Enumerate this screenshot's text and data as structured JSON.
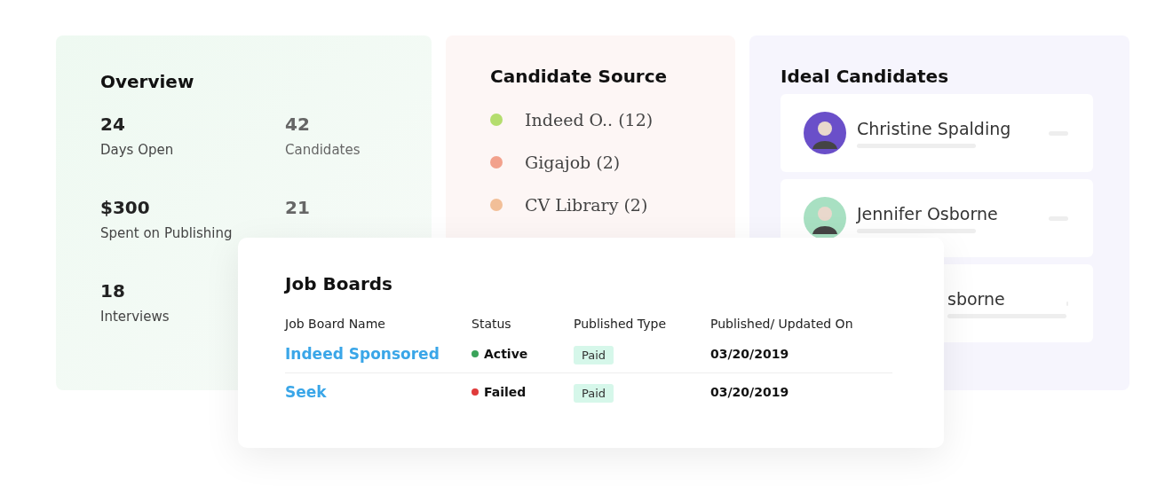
{
  "overview": {
    "title": "Overview",
    "stats": [
      {
        "value": "24",
        "label": "Days Open"
      },
      {
        "value": "42",
        "label": "Candidates"
      },
      {
        "value": "$300",
        "label": "Spent on Publishing"
      },
      {
        "value": "21"
      },
      {
        "value": "18",
        "label": "Interviews"
      }
    ]
  },
  "candidate_source": {
    "title": "Candidate Source",
    "items": [
      {
        "label": "Indeed O.. (12)",
        "color": "#b4dd6e"
      },
      {
        "label": "Gigajob (2)",
        "color": "#f2a18c"
      },
      {
        "label": "CV Library (2)",
        "color": "#f2bf98"
      }
    ]
  },
  "ideal_candidates": {
    "title": "Ideal Candidates",
    "items": [
      {
        "name": "Christine Spalding",
        "avatar": true,
        "color": "#6a4fc9"
      },
      {
        "name": "Jennifer Osborne",
        "avatar": true,
        "color": "#a8e0c2"
      },
      {
        "name": "sborne",
        "avatar": false
      }
    ]
  },
  "job_boards": {
    "title": "Job Boards",
    "columns": [
      "Job Board Name",
      "Status",
      "Published Type",
      "Published/ Updated On"
    ],
    "rows": [
      {
        "name": "Indeed Sponsored",
        "status": "Active",
        "color": "#3aa35a",
        "type": "Paid",
        "date": "03/20/2019"
      },
      {
        "name": "Seek",
        "status": "Failed",
        "color": "#e03b3b",
        "type": "Paid",
        "date": "03/20/2019"
      }
    ]
  }
}
